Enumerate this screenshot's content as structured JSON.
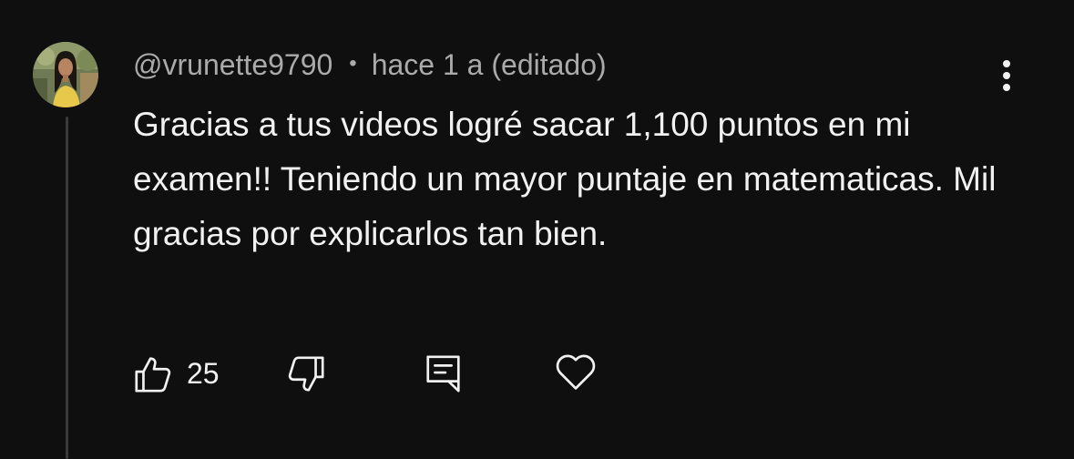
{
  "comment": {
    "author": "@vrunette9790",
    "separator": "•",
    "time": "hace 1 a (editado)",
    "text": "Gracias a tus videos logré sacar 1,100 puntos en mi examen!! Teniendo un mayor puntaje en matematicas. Mil gracias por explicarlos tan bien.",
    "like_count": "25"
  },
  "icons": {
    "like": "thumbs-up-icon",
    "dislike": "thumbs-down-icon",
    "reply": "comment-reply-icon",
    "heart": "heart-icon",
    "more": "more-vertical-icon"
  },
  "colors": {
    "background": "#0f0f0f",
    "text": "#f1f1f1",
    "secondary_text": "#aaaaaa"
  }
}
